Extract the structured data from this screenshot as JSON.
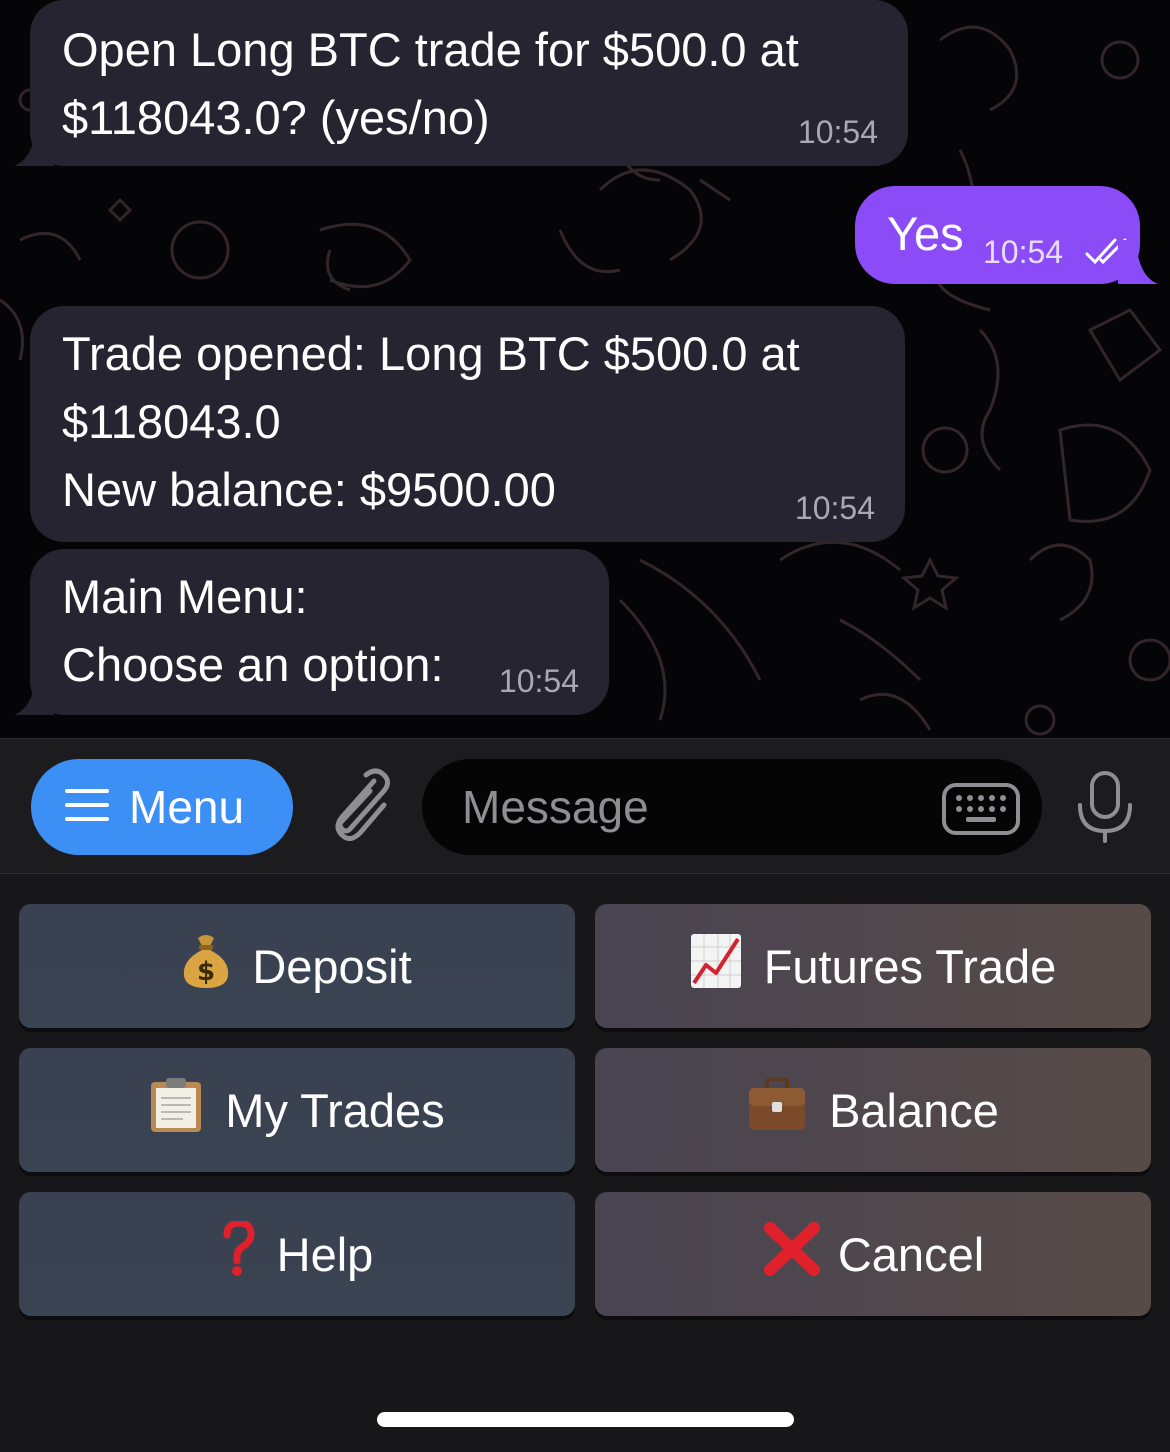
{
  "messages": [
    {
      "lines": [
        "Open Long BTC trade for $500.0 at",
        "$118043.0? (yes/no)"
      ],
      "time": "10:54"
    },
    {
      "text": "Yes",
      "time": "10:54",
      "status_icon": "double-check-icon"
    },
    {
      "lines": [
        "Trade opened: Long BTC $500.0 at",
        "$118043.0",
        "New balance: $9500.00"
      ],
      "time": "10:54"
    },
    {
      "lines": [
        "Main Menu:",
        "Choose an option:"
      ],
      "time": "10:54"
    }
  ],
  "input_bar": {
    "menu_label": "Menu",
    "message_placeholder": "Message",
    "icons": [
      "hamburger-icon",
      "paperclip-icon",
      "keyboard-icon",
      "microphone-icon"
    ]
  },
  "reply_keyboard": [
    {
      "label": "Deposit",
      "icon": "money-bag-icon"
    },
    {
      "label": "Futures Trade",
      "icon": "chart-increasing-icon"
    },
    {
      "label": "My Trades",
      "icon": "clipboard-icon"
    },
    {
      "label": "Balance",
      "icon": "briefcase-icon"
    },
    {
      "label": "Help",
      "icon": "question-mark-icon"
    },
    {
      "label": "Cancel",
      "icon": "cross-mark-icon"
    }
  ],
  "colors": {
    "incoming_bubble": "#262430",
    "outgoing_bubble": "#8b4cf7",
    "menu_button": "#3b8ff5",
    "cancel_x": "#e0202a",
    "help_question": "#e0202a"
  }
}
